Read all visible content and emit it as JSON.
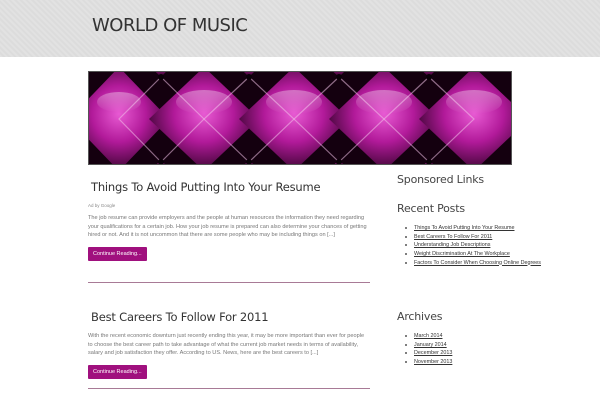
{
  "site": {
    "title": "WORLD OF MUSIC"
  },
  "posts": [
    {
      "title": "Things To Avoid Putting Into Your Resume",
      "meta": "Ad by Google",
      "excerpt": "The job resume can provide employers and the people at human resources the information they need regarding your qualifications for a certain job. How your job resume is prepared can also determine your chances of getting hired or not. And it is not uncommon that there are some people who may be including things on [...]",
      "button": "Continue Reading..."
    },
    {
      "title": "Best Careers To Follow For 2011",
      "excerpt": "With the recent economic downturn just recently ending this year, it may be more important than ever for people to choose the best career path to take advantage of what the current job market needs in terms of availability, salary and job satisfaction they offer. According to US. News, here are the best careers to [...]",
      "button": "Continue Reading..."
    }
  ],
  "sidebar": {
    "sponsored": {
      "title": "Sponsored Links"
    },
    "recent": {
      "title": "Recent Posts",
      "items": [
        "Things To Avoid Putting Into Your Resume",
        "Best Careers To Follow For 2011",
        "Understanding Job Descriptions",
        "Weight Discrimination At The Workplace",
        "Factors To Consider When Choosing Online Degrees"
      ]
    },
    "archives": {
      "title": "Archives",
      "items": [
        "March 2014",
        "January 2014",
        "December 2013",
        "November 2013"
      ]
    }
  },
  "colors": {
    "accent": "#a0107e",
    "divider": "#a87a96",
    "header_bg": "#dedede"
  }
}
